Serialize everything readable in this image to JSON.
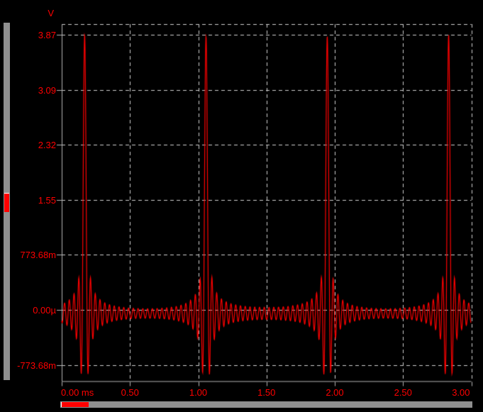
{
  "colors": {
    "background": "#000000",
    "trace": "#ff0000",
    "label_text": "#ff0000",
    "grid_dashed": "#cfcfcf",
    "axis_solid": "#b3b3b3",
    "scrollbar_track": "#8f8f8f",
    "scrollbar_thumb": "#ff0000",
    "scrollbar_thumb_highlight": "#ffffff"
  },
  "chart_data": {
    "type": "line",
    "title": "",
    "ylabel": "V",
    "xlabel": "",
    "x_unit": "ms",
    "xlim": [
      0,
      3
    ],
    "ylim_volts": [
      -1.0,
      4.02
    ],
    "grid": "dashed",
    "legend_position": "none",
    "x_ticks": [
      {
        "value": 0.0,
        "label": "0.00 ms"
      },
      {
        "value": 0.5,
        "label": "0.50"
      },
      {
        "value": 1.0,
        "label": "1.00"
      },
      {
        "value": 1.5,
        "label": "1.50"
      },
      {
        "value": 2.0,
        "label": "2.00"
      },
      {
        "value": 2.5,
        "label": "2.50"
      },
      {
        "value": 3.0,
        "label": "3.00"
      }
    ],
    "y_ticks": [
      {
        "value": 3.87,
        "label": "3.87"
      },
      {
        "value": 3.09472,
        "label": "3.09"
      },
      {
        "value": 2.32104,
        "label": "2.32"
      },
      {
        "value": 1.54736,
        "label": "1.55"
      },
      {
        "value": 0.77368,
        "label": "773.68m"
      },
      {
        "value": 0.0,
        "label": "0.00µ"
      },
      {
        "value": -0.77368,
        "label": "-773.68m"
      }
    ],
    "series": [
      {
        "name": "V",
        "color": "#ff0000",
        "waveform": "sinc_pulse_train",
        "pulse_times_ms": [
          0.168,
          1.057,
          1.945,
          2.834
        ],
        "pulse_period_ms": 0.889,
        "peak_v": 3.95,
        "sinc_zero_spacing_ms": 0.0172,
        "baseline_offset_v": -0.05,
        "first_sidelobe_v": -0.91,
        "second_sidelobe_v": 0.46
      }
    ]
  },
  "scrollbars": {
    "vertical": {
      "thumb_fraction_top": 0.476,
      "thumb_fraction_size": 0.054
    },
    "horizontal": {
      "thumb_fraction_left": 0.002,
      "thumb_fraction_size": 0.067
    }
  }
}
